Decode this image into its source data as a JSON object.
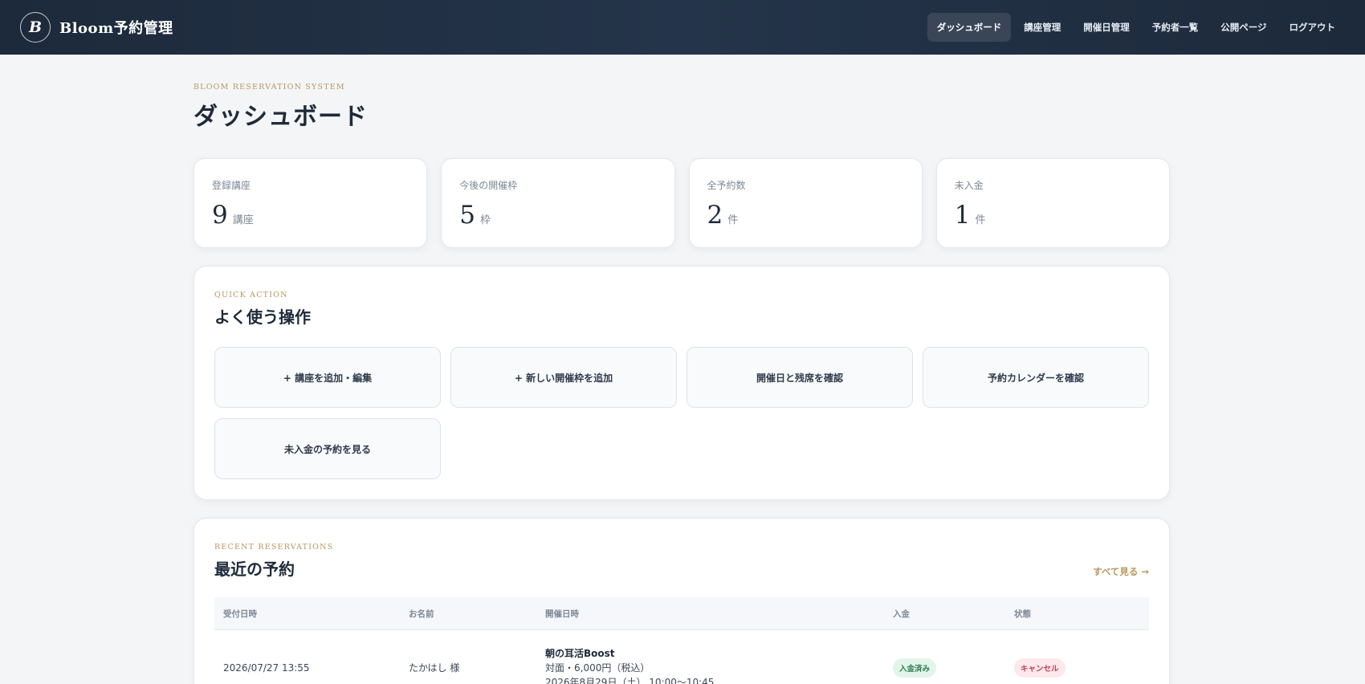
{
  "header": {
    "logo_letter": "B",
    "brand_name": "Bloom予約管理",
    "nav": [
      "ダッシュボード",
      "講座管理",
      "開催日管理",
      "予約者一覧",
      "公開ページ",
      "ログアウト"
    ]
  },
  "page": {
    "eyebrow": "BLOOM RESERVATION SYSTEM",
    "title": "ダッシュボード"
  },
  "stats": [
    {
      "label": "登録講座",
      "value": "9",
      "unit": "講座"
    },
    {
      "label": "今後の開催枠",
      "value": "5",
      "unit": "枠"
    },
    {
      "label": "全予約数",
      "value": "2",
      "unit": "件"
    },
    {
      "label": "未入金",
      "value": "1",
      "unit": "件"
    }
  ],
  "quick_action": {
    "eyebrow": "QUICK ACTION",
    "title": "よく使う操作",
    "buttons": [
      "+ 講座を追加・編集",
      "+ 新しい開催枠を追加",
      "開催日と残席を確認",
      "予約カレンダーを確認",
      "未入金の予約を見る"
    ]
  },
  "recent": {
    "eyebrow": "RECENT RESERVATIONS",
    "title": "最近の予約",
    "see_all": "すべて見る →",
    "columns": [
      "受付日時",
      "お名前",
      "開催日時",
      "入金",
      "状態"
    ],
    "rows": [
      {
        "received": "2026/07/27 13:55",
        "name": "たかはし 様",
        "course": "朝の耳活Boost",
        "course_detail": "対面・6,000円（税込）",
        "course_date": "2026年8月29日（土） 10:00〜10:45",
        "payment": "入金済み",
        "status": "キャンセル"
      }
    ]
  },
  "colors": {
    "header_bg": "#1d2a3b",
    "accent_gold": "#b8975f",
    "paid_badge": "#2f7d4f",
    "cancel_badge": "#c0405a"
  }
}
